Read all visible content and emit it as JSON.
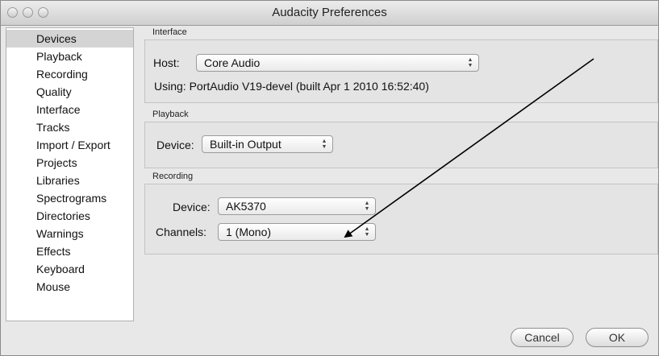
{
  "window": {
    "title": "Audacity Preferences"
  },
  "sidebar": {
    "items": [
      {
        "label": "Devices",
        "selected": true
      },
      {
        "label": "Playback"
      },
      {
        "label": "Recording"
      },
      {
        "label": "Quality"
      },
      {
        "label": "Interface"
      },
      {
        "label": "Tracks"
      },
      {
        "label": "Import / Export"
      },
      {
        "label": "Projects"
      },
      {
        "label": "Libraries"
      },
      {
        "label": "Spectrograms"
      },
      {
        "label": "Directories"
      },
      {
        "label": "Warnings"
      },
      {
        "label": "Effects"
      },
      {
        "label": "Keyboard"
      },
      {
        "label": "Mouse"
      }
    ]
  },
  "interface": {
    "group_label": "Interface",
    "host_label": "Host:",
    "host_value": "Core Audio",
    "using_text": "Using: PortAudio V19-devel (built Apr  1 2010 16:52:40)"
  },
  "playback": {
    "group_label": "Playback",
    "device_label": "Device:",
    "device_value": "Built-in Output"
  },
  "recording": {
    "group_label": "Recording",
    "device_label": "Device:",
    "device_value": "AK5370",
    "channels_label": "Channels:",
    "channels_value": "1 (Mono)"
  },
  "buttons": {
    "cancel": "Cancel",
    "ok": "OK"
  },
  "icons": {
    "stepper": "updown-arrows-icon",
    "annotation": "arrow-annotation"
  },
  "colors": {
    "selection": "#d4d4d4",
    "window_bg": "#e8e8e8",
    "arrow": "#000000"
  }
}
